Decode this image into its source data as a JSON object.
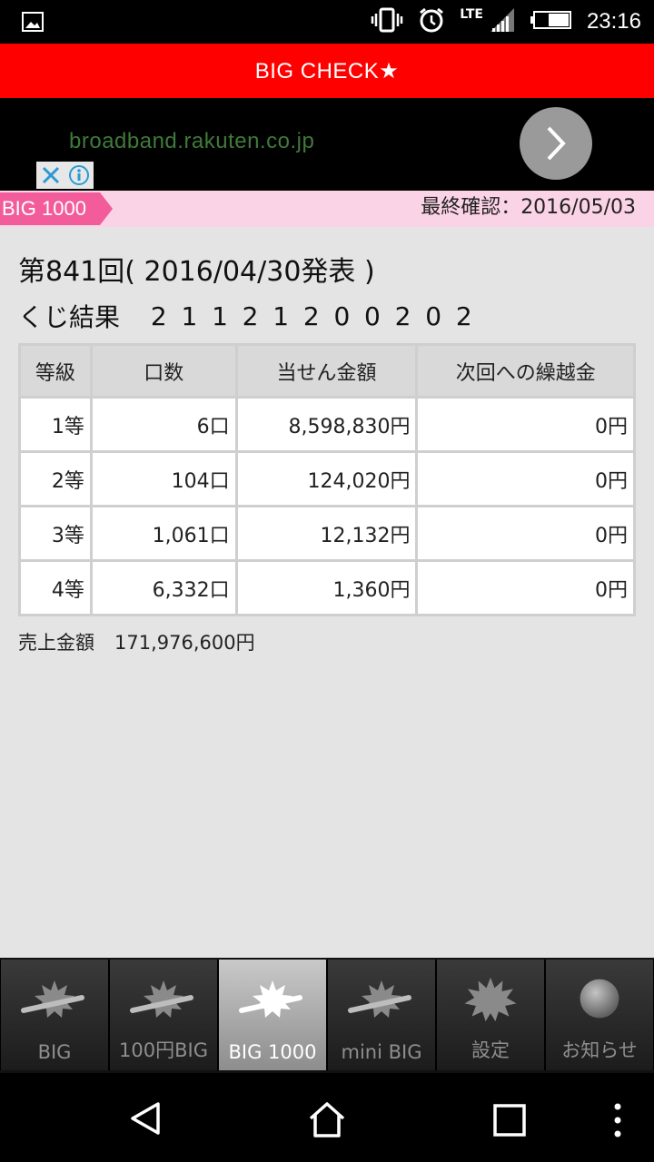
{
  "status_bar": {
    "network": "LTE",
    "time": "23:16",
    "icons": [
      "image-notification-icon",
      "vibrate-icon",
      "alarm-icon",
      "signal-icon",
      "battery-icon"
    ]
  },
  "app": {
    "title": "BIG CHECK★",
    "brand_color": "#ff0000"
  },
  "ad": {
    "url": "broadband.rakuten.co.jp"
  },
  "sub_header": {
    "game_label": "BIG 1000",
    "last_checked": "最終確認：2016/05/03"
  },
  "draw": {
    "title": "第841回( 2016/04/30発表 )",
    "result_label": "くじ結果",
    "numbers": [
      "2",
      "1",
      "1",
      "2",
      "1",
      "2",
      "0",
      "0",
      "2",
      "0",
      "2"
    ]
  },
  "table": {
    "headers": [
      "等級",
      "口数",
      "当せん金額",
      "次回への繰越金"
    ],
    "rows": [
      [
        "1等",
        "6口",
        "8,598,830円",
        "0円"
      ],
      [
        "2等",
        "104口",
        "124,020円",
        "0円"
      ],
      [
        "3等",
        "1,061口",
        "12,132円",
        "0円"
      ],
      [
        "4等",
        "6,332口",
        "1,360円",
        "0円"
      ]
    ]
  },
  "sales": {
    "label": "売上金額",
    "value": "171,976,600円"
  },
  "tabs": [
    {
      "label": "BIG",
      "icon": "starburst-ball-icon",
      "active": false
    },
    {
      "label": "100円BIG",
      "icon": "starburst-ball-icon",
      "active": false
    },
    {
      "label": "BIG 1000",
      "icon": "starburst-ball-icon",
      "active": true
    },
    {
      "label": "mini BIG",
      "icon": "starburst-ball-icon",
      "active": false
    },
    {
      "label": "設定",
      "icon": "starburst-icon",
      "active": false
    },
    {
      "label": "お知らせ",
      "icon": "ball-icon",
      "active": false
    }
  ],
  "nav": {
    "icons": [
      "back-icon",
      "home-icon",
      "recents-icon",
      "more-icon"
    ]
  }
}
